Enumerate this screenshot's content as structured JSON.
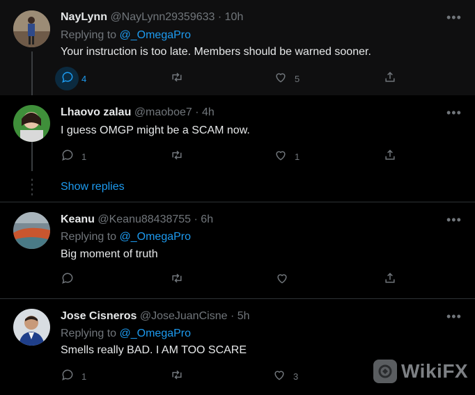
{
  "tweets": [
    {
      "name": "NayLynn",
      "handle": "@NayLynn29359633",
      "time": "10h",
      "replying_label": "Replying to",
      "replying_to": "@_OmegaPro",
      "text": "Your instruction is too late. Members should be warned sooner.",
      "replies": "4",
      "likes": "5"
    },
    {
      "name": "Lhaovo zalau",
      "handle": "@maoboe7",
      "time": "4h",
      "text": "I guess OMGP might be a SCAM now.",
      "replies": "1",
      "likes": "1",
      "show_replies": "Show replies"
    },
    {
      "name": "Keanu",
      "handle": "@Keanu88438755",
      "time": "6h",
      "replying_label": "Replying to",
      "replying_to": "@_OmegaPro",
      "text": "Big moment of truth"
    },
    {
      "name": "Jose Cisneros",
      "handle": "@JoseJuanCisne",
      "time": "5h",
      "replying_label": "Replying to",
      "replying_to": "@_OmegaPro",
      "text": "Smells really BAD. I AM TOO SCARE",
      "replies": "1",
      "likes": "3"
    }
  ],
  "separator": "·",
  "more_glyph": "•••",
  "watermark": {
    "text": "WikiFX"
  },
  "colors": {
    "background": "#000000",
    "accent": "#1d9bf0",
    "muted": "#71767b",
    "text": "#e7e9ea"
  },
  "icons": [
    "reply-icon",
    "retweet-icon",
    "like-icon",
    "share-icon",
    "more-icon"
  ]
}
